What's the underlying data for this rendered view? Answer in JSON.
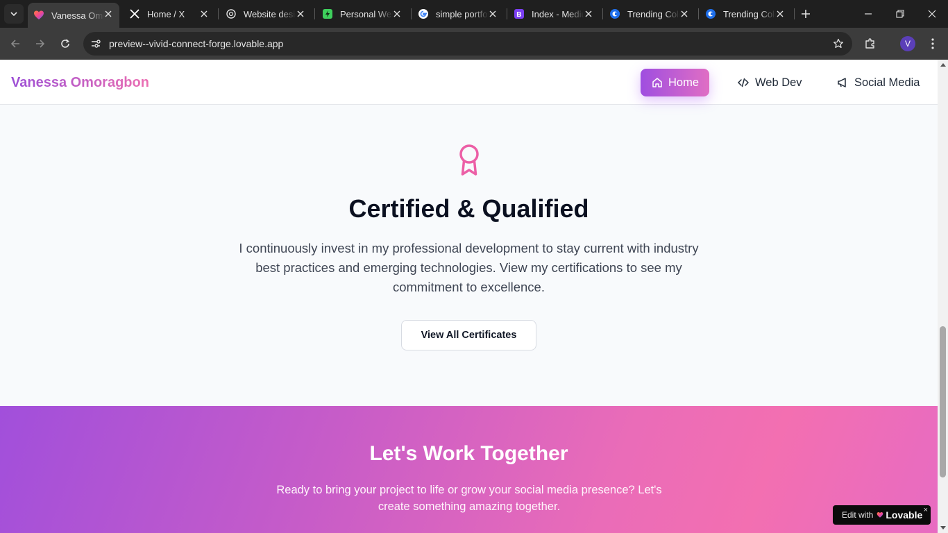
{
  "browser": {
    "tabs": [
      {
        "title": "Vanessa Omoragbon",
        "icon": "lovable-favicon",
        "active": true
      },
      {
        "title": "Home / X",
        "icon": "x-favicon",
        "active": false
      },
      {
        "title": "Website design",
        "icon": "openai-favicon",
        "active": false
      },
      {
        "title": "Personal Website",
        "icon": "green-favicon",
        "active": false
      },
      {
        "title": "simple portfolio",
        "icon": "google-favicon",
        "active": false
      },
      {
        "title": "Index - Medium",
        "icon": "bootstrap-favicon",
        "active": false
      },
      {
        "title": "Trending Colors",
        "icon": "coolors-favicon",
        "active": false
      },
      {
        "title": "Trending Colors",
        "icon": "coolors-favicon",
        "active": false
      }
    ],
    "url": "preview--vivid-connect-forge.lovable.app",
    "profile_initial": "V"
  },
  "site": {
    "brand": "Vanessa Omoragbon",
    "nav": {
      "home": "Home",
      "webdev": "Web Dev",
      "social": "Social Media"
    }
  },
  "cert": {
    "icon": "award-icon",
    "title": "Certified & Qualified",
    "text": "I continuously invest in my professional development to stay current with industry best practices and emerging technologies. View my certifications to see my commitment to excellence.",
    "button": "View All Certificates"
  },
  "contact": {
    "title": "Let's Work Together",
    "text": "Ready to bring your project to life or grow your social media presence? Let's create something amazing together."
  },
  "badge": {
    "prefix": "Edit with",
    "brand": "Lovable",
    "close": "×"
  },
  "colors": {
    "accent_purple": "#a14fdb",
    "accent_pink": "#f36fb1",
    "award_pink": "#ec5fa6"
  }
}
